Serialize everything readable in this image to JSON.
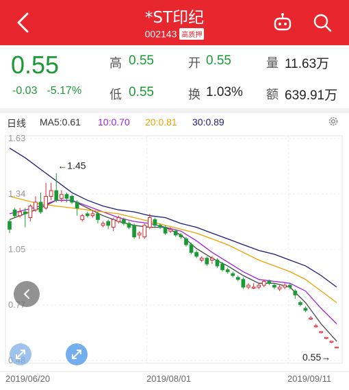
{
  "header": {
    "title": "*ST印纪",
    "code": "002143",
    "badge": "高质押"
  },
  "quote": {
    "price": "0.55",
    "change": "-0.03",
    "change_pct": "-5.17%",
    "high_label": "高",
    "high": "0.55",
    "open_label": "开",
    "open": "0.55",
    "volume_label": "量",
    "volume": "11.63万",
    "low_label": "低",
    "low": "0.55",
    "turnover_label": "换",
    "turnover": "1.03%",
    "amount_label": "额",
    "amount": "639.91万"
  },
  "legend": {
    "period": "日线",
    "ma5": "MA5:0.61",
    "ma10": "10:0.70",
    "ma20": "20:0.81",
    "ma30": "30:0.89"
  },
  "colors": {
    "brand_red": "#e8262d",
    "up": "#e0242a",
    "down": "#1a9a35",
    "ma5": "#444444",
    "ma10": "#a020d8",
    "ma20": "#f0a000",
    "ma30": "#1a1a7a"
  },
  "chart_data": {
    "type": "candlestick",
    "y_ticks": [
      "1.63",
      "1.34",
      "1.05",
      "0.77",
      "0.48"
    ],
    "ylim": [
      0.48,
      1.63
    ],
    "x_ticks": [
      "2019/06/20",
      "2019/08/01",
      "2019/09/11"
    ],
    "max_annotation": "←1.45",
    "last_annotation": "0.55→",
    "grid": true,
    "candles": [
      [
        1.2,
        1.16,
        1.21,
        1.14
      ],
      [
        1.26,
        1.23,
        1.27,
        1.22
      ],
      [
        1.23,
        1.25,
        1.27,
        1.22
      ],
      [
        1.25,
        1.24,
        1.27,
        1.17
      ],
      [
        1.22,
        1.28,
        1.29,
        1.2
      ],
      [
        1.26,
        1.3,
        1.33,
        1.25
      ],
      [
        1.3,
        1.25,
        1.35,
        1.24
      ],
      [
        1.27,
        1.33,
        1.4,
        1.26
      ],
      [
        1.33,
        1.36,
        1.4,
        1.31
      ],
      [
        1.36,
        1.31,
        1.45,
        1.3
      ],
      [
        1.32,
        1.34,
        1.36,
        1.3
      ],
      [
        1.34,
        1.32,
        1.35,
        1.3
      ],
      [
        1.33,
        1.3,
        1.34,
        1.29
      ],
      [
        1.3,
        1.27,
        1.31,
        1.23
      ],
      [
        1.21,
        1.23,
        1.24,
        1.2
      ],
      [
        1.24,
        1.23,
        1.25,
        1.22
      ],
      [
        1.23,
        1.24,
        1.26,
        1.22
      ],
      [
        1.24,
        1.21,
        1.25,
        1.19
      ],
      [
        1.18,
        1.19,
        1.2,
        1.17
      ],
      [
        1.2,
        1.18,
        1.21,
        1.16
      ],
      [
        1.17,
        1.21,
        1.22,
        1.15
      ],
      [
        1.2,
        1.22,
        1.23,
        1.19
      ],
      [
        1.21,
        1.19,
        1.22,
        1.18
      ],
      [
        1.19,
        1.17,
        1.2,
        1.16
      ],
      [
        1.18,
        1.12,
        1.19,
        1.11
      ],
      [
        1.13,
        1.14,
        1.15,
        1.11
      ],
      [
        1.12,
        1.18,
        1.19,
        1.11
      ],
      [
        1.17,
        1.22,
        1.24,
        1.16
      ],
      [
        1.21,
        1.18,
        1.22,
        1.17
      ],
      [
        1.18,
        1.17,
        1.19,
        1.16
      ],
      [
        1.17,
        1.14,
        1.18,
        1.13
      ],
      [
        1.15,
        1.16,
        1.17,
        1.14
      ],
      [
        1.15,
        1.13,
        1.16,
        1.12
      ],
      [
        1.13,
        1.12,
        1.14,
        1.11
      ],
      [
        1.11,
        1.08,
        1.12,
        1.07
      ],
      [
        1.08,
        1.04,
        1.09,
        1.03
      ],
      [
        1.04,
        1.02,
        1.05,
        1.01
      ],
      [
        1.0,
        1.01,
        1.02,
        0.99
      ],
      [
        1.01,
        0.98,
        1.02,
        0.97
      ],
      [
        1.0,
        1.01,
        1.02,
        0.98
      ],
      [
        1.0,
        0.97,
        1.01,
        0.96
      ],
      [
        0.98,
        0.95,
        0.99,
        0.94
      ],
      [
        0.95,
        0.94,
        0.96,
        0.93
      ],
      [
        0.93,
        0.92,
        0.94,
        0.91
      ],
      [
        0.91,
        0.9,
        0.92,
        0.89
      ],
      [
        0.9,
        0.86,
        0.91,
        0.85
      ],
      [
        0.86,
        0.87,
        0.88,
        0.85
      ],
      [
        0.86,
        0.86,
        0.88,
        0.85
      ],
      [
        0.86,
        0.87,
        0.88,
        0.85
      ],
      [
        0.87,
        0.89,
        0.9,
        0.86
      ],
      [
        0.89,
        0.88,
        0.9,
        0.87
      ],
      [
        0.87,
        0.86,
        0.88,
        0.85
      ],
      [
        0.85,
        0.86,
        0.87,
        0.84
      ],
      [
        0.86,
        0.87,
        0.88,
        0.85
      ],
      [
        0.87,
        0.86,
        0.88,
        0.85
      ],
      [
        0.84,
        0.82,
        0.85,
        0.8
      ],
      [
        0.78,
        0.77,
        0.79,
        0.76
      ],
      [
        0.75,
        0.74,
        0.76,
        0.73
      ],
      [
        0.7,
        0.7,
        0.71,
        0.69
      ],
      [
        0.66,
        0.66,
        0.67,
        0.65
      ],
      [
        0.63,
        0.63,
        0.63,
        0.62
      ],
      [
        0.6,
        0.6,
        0.6,
        0.59
      ],
      [
        0.58,
        0.58,
        0.58,
        0.57
      ],
      [
        0.55,
        0.55,
        0.55,
        0.55
      ]
    ],
    "ma_series": [
      {
        "name": "MA5",
        "values": [
          [
            0,
            1.21
          ],
          [
            3,
            1.24
          ],
          [
            6,
            1.27
          ],
          [
            9,
            1.31
          ],
          [
            12,
            1.31
          ],
          [
            15,
            1.27
          ],
          [
            18,
            1.23
          ],
          [
            21,
            1.2
          ],
          [
            24,
            1.18
          ],
          [
            27,
            1.17
          ],
          [
            30,
            1.17
          ],
          [
            33,
            1.13
          ],
          [
            36,
            1.06
          ],
          [
            39,
            1.01
          ],
          [
            42,
            0.97
          ],
          [
            45,
            0.92
          ],
          [
            48,
            0.88
          ],
          [
            51,
            0.88
          ],
          [
            54,
            0.86
          ],
          [
            57,
            0.78
          ],
          [
            60,
            0.67
          ],
          [
            63,
            0.58
          ]
        ]
      },
      {
        "name": "10",
        "values": [
          [
            0,
            1.24
          ],
          [
            3,
            1.26
          ],
          [
            6,
            1.28
          ],
          [
            9,
            1.31
          ],
          [
            12,
            1.31
          ],
          [
            15,
            1.28
          ],
          [
            18,
            1.25
          ],
          [
            21,
            1.22
          ],
          [
            24,
            1.2
          ],
          [
            27,
            1.19
          ],
          [
            30,
            1.17
          ],
          [
            33,
            1.15
          ],
          [
            36,
            1.1
          ],
          [
            39,
            1.04
          ],
          [
            42,
            0.99
          ],
          [
            45,
            0.94
          ],
          [
            48,
            0.9
          ],
          [
            51,
            0.89
          ],
          [
            54,
            0.88
          ],
          [
            57,
            0.84
          ],
          [
            60,
            0.75
          ],
          [
            63,
            0.67
          ]
        ]
      },
      {
        "name": "20",
        "values": [
          [
            0,
            1.33
          ],
          [
            3,
            1.31
          ],
          [
            6,
            1.29
          ],
          [
            9,
            1.28
          ],
          [
            12,
            1.27
          ],
          [
            15,
            1.26
          ],
          [
            18,
            1.25
          ],
          [
            21,
            1.24
          ],
          [
            24,
            1.22
          ],
          [
            27,
            1.2
          ],
          [
            30,
            1.18
          ],
          [
            33,
            1.16
          ],
          [
            36,
            1.14
          ],
          [
            39,
            1.11
          ],
          [
            42,
            1.08
          ],
          [
            45,
            1.04
          ],
          [
            48,
            1.0
          ],
          [
            51,
            0.97
          ],
          [
            54,
            0.94
          ],
          [
            57,
            0.9
          ],
          [
            60,
            0.84
          ],
          [
            63,
            0.78
          ]
        ]
      },
      {
        "name": "30",
        "values": [
          [
            0,
            1.58
          ],
          [
            3,
            1.53
          ],
          [
            6,
            1.47
          ],
          [
            9,
            1.41
          ],
          [
            12,
            1.35
          ],
          [
            15,
            1.31
          ],
          [
            18,
            1.28
          ],
          [
            21,
            1.26
          ],
          [
            24,
            1.25
          ],
          [
            27,
            1.23
          ],
          [
            30,
            1.22
          ],
          [
            33,
            1.19
          ],
          [
            36,
            1.17
          ],
          [
            39,
            1.14
          ],
          [
            42,
            1.11
          ],
          [
            45,
            1.08
          ],
          [
            48,
            1.05
          ],
          [
            51,
            1.03
          ],
          [
            54,
            1.0
          ],
          [
            57,
            0.97
          ],
          [
            60,
            0.92
          ],
          [
            63,
            0.86
          ]
        ]
      }
    ]
  }
}
